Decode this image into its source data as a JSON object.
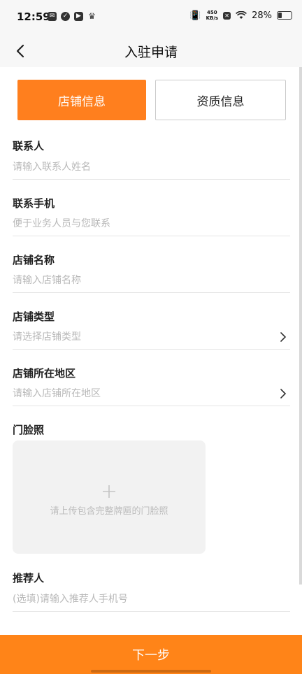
{
  "status_bar": {
    "time": "12:59",
    "net_speed_top": "450",
    "net_speed_bottom": "KB/s",
    "battery": "28%"
  },
  "nav": {
    "back_icon": "chevron-left-icon",
    "title": "入驻申请"
  },
  "tabs": [
    {
      "label": "店铺信息",
      "active": true
    },
    {
      "label": "资质信息",
      "active": false
    }
  ],
  "form": {
    "contact": {
      "label": "联系人",
      "placeholder": "请输入联系人姓名"
    },
    "phone": {
      "label": "联系手机",
      "placeholder": "便于业务人员与您联系"
    },
    "store_name": {
      "label": "店铺名称",
      "placeholder": "请输入店铺名称"
    },
    "store_type": {
      "label": "店铺类型",
      "placeholder": "请选择店铺类型"
    },
    "store_region": {
      "label": "店铺所在地区",
      "placeholder": "请输入店铺所在地区"
    },
    "storefront": {
      "label": "门脸照",
      "hint": "请上传包含完整牌匾的门脸照"
    },
    "referrer": {
      "label": "推荐人",
      "placeholder": "(选填)请输入推荐人手机号"
    }
  },
  "footer": {
    "next_label": "下一步"
  },
  "colors": {
    "accent": "#ff7f1e",
    "footer": "#ff8418"
  }
}
